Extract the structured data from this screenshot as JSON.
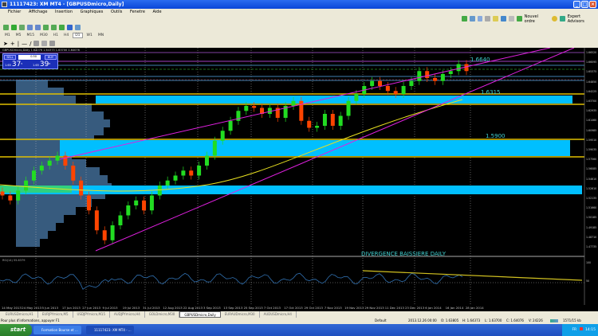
{
  "window": {
    "title": "11117423: XM MT4 - [GBPUSDmicro,Daily]"
  },
  "menu": [
    "Fichier",
    "Affichage",
    "Insertion",
    "Graphiques",
    "Outils",
    "Fenetre",
    "Aide"
  ],
  "toolbar": {
    "new_order": "Nouvel ordre",
    "expert_advisors": "Expert Advisors"
  },
  "timeframes": [
    "M1",
    "M5",
    "M15",
    "M30",
    "H1",
    "H4",
    "D1",
    "W1",
    "MN"
  ],
  "chart": {
    "header": "GBPUSDmicro,Daily 1.64076 1.64373 1.63700 1.64076",
    "trade_panel": {
      "sell": "SELL",
      "buy": "BUY",
      "lot": "0.50",
      "sell_prefix": "1.65",
      "sell_big": "37",
      "sell_sup": "5",
      "buy_prefix": "1.65",
      "buy_big": "39",
      "buy_sup": "8"
    },
    "levels": [
      {
        "label": "1.6640",
        "price": 1.664
      },
      {
        "label": "1.6315",
        "price": 1.6315
      },
      {
        "label": "1.5900",
        "price": 1.59
      }
    ],
    "price_axis": [
      "1.66520",
      "1.66095",
      "1.65375",
      "1.64850",
      "1.64225",
      "1.63700",
      "1.62935",
      "1.61460",
      "1.60985",
      "1.59510",
      "1.59035",
      "1.57560",
      "1.56085",
      "1.54610",
      "1.52610",
      "1.52135",
      "1.51660",
      "1.50185",
      "1.49185",
      "1.48710",
      "1.47735"
    ],
    "closes": [
      1.53,
      1.525,
      1.535,
      1.545,
      1.555,
      1.56,
      1.565,
      1.57,
      1.56,
      1.545,
      1.53,
      1.515,
      1.495,
      1.485,
      1.5,
      1.51,
      1.52,
      1.525,
      1.515,
      1.53,
      1.54,
      1.545,
      1.55,
      1.555,
      1.55,
      1.56,
      1.57,
      1.585,
      1.595,
      1.605,
      1.615,
      1.62,
      1.618,
      1.612,
      1.618,
      1.608,
      1.62,
      1.625,
      1.605,
      1.598,
      1.6,
      1.612,
      1.6,
      1.61,
      1.625,
      1.632,
      1.64,
      1.645,
      1.64,
      1.635,
      1.632,
      1.64,
      1.645,
      1.655,
      1.648,
      1.645,
      1.652,
      1.655,
      1.662,
      1.655
    ],
    "colors": {
      "bull": "#22dd22",
      "bear": "#ff4400",
      "zone": "#00bfff",
      "level": "#e0c000",
      "channel": "#e020e0"
    },
    "rsi_label": "RSI(14) 55.6379",
    "rsi_levels": [
      "100",
      "50"
    ],
    "annotation": "DIVERGENCE BAISSIERE DAILY"
  },
  "dates": [
    "14 May 2013",
    "24 May 2013",
    "5 Jun 2013",
    "17 Jun 2013",
    "27 Jun 2013",
    "9 Jul 2013",
    "19 Jul 2013",
    "31 Jul 2013",
    "12 Aug 2013",
    "22 Aug 2013",
    "3 Sep 2013",
    "13 Sep 2013",
    "25 Sep 2013",
    "7 Oct 2013",
    "17 Oct 2013",
    "29 Oct 2013",
    "7 Nov 2013",
    "19 Nov 2013",
    "29 Nov 2013",
    "11 Dec 2013",
    "23 Dec 2013",
    "6 Jan 2014",
    "16 Jan 2014",
    "28 Jan 2014"
  ],
  "tabs": [
    "EURUSDmicro,H1",
    "EURJPYmicro,M5",
    "USDJPYmicro,M15",
    "AUDJPYmicro,H4",
    "GOLDmicro,M30",
    "GBPUSDmicro,Daily",
    "EURAUDmicro,M30",
    "AUDUSDmicro,H4"
  ],
  "active_tab": 5,
  "status": {
    "help": "Pour plus d'informations, appuyer F1",
    "profile": "Default",
    "time": "2013.12.26 00:00",
    "open": "O: 1.63805",
    "high": "H: 1.64373",
    "low": "L: 1.63700",
    "close": "C: 1.64076",
    "volume": "V: 24226",
    "traffic": "1571/15 kb"
  },
  "taskbar": {
    "start": "start",
    "tasks": [
      "Formation Bourse et ...",
      "11117423: XM MT4 - ..."
    ],
    "lang": "FR",
    "clock": "14:15"
  }
}
